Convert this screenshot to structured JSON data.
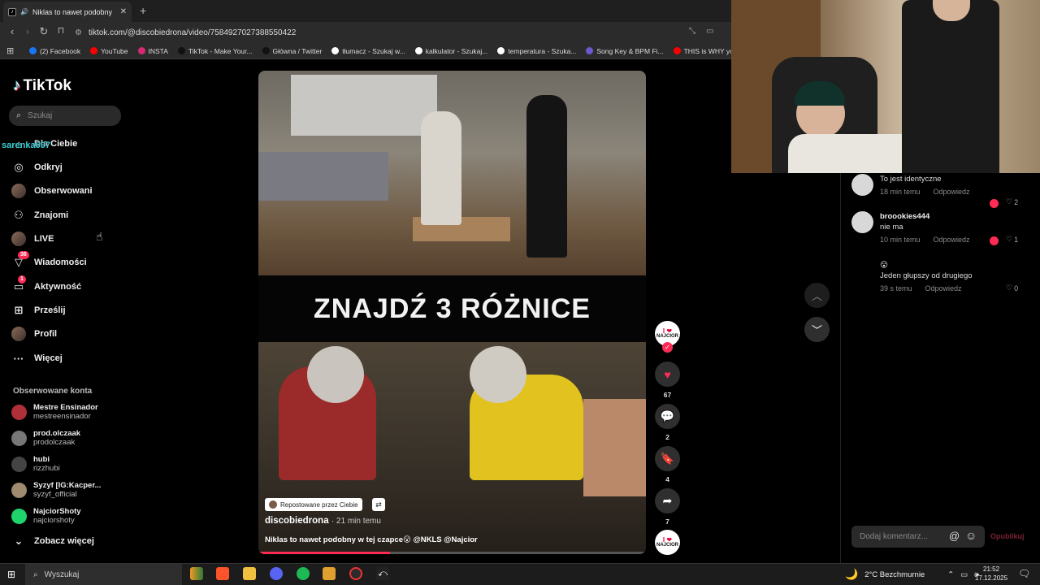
{
  "browser": {
    "tab_title": "Niklas to nawet podobny w te",
    "tab_close": "✕",
    "new_tab": "+",
    "url": "tiktok.com/@discobiedrona/video/7584927027388550422",
    "bookmarks": [
      {
        "label": "(2) Facebook",
        "color": "#1877f2"
      },
      {
        "label": "YouTube",
        "color": "#ff0000"
      },
      {
        "label": "INSTA",
        "color": "#d62976"
      },
      {
        "label": "TikTok - Make Your...",
        "color": "#111111"
      },
      {
        "label": "Główna / Twitter",
        "color": "#111111"
      },
      {
        "label": "tłumacz - Szukaj w...",
        "color": "#ffffff"
      },
      {
        "label": "kalkulator - Szukaj...",
        "color": "#ffffff"
      },
      {
        "label": "temperatura - Szuka...",
        "color": "#ffffff"
      },
      {
        "label": "Song Key & BPM Fi...",
        "color": "#6a5acd"
      },
      {
        "label": "THIS is WHY your Kl...",
        "color": "#ff0000"
      }
    ]
  },
  "sidebar": {
    "logo": "TikTok",
    "search_placeholder": "Szukaj",
    "overlay_username": "sarenka597",
    "nav": [
      {
        "label": "Dla Ciebie",
        "icon": "home-icon",
        "glyph": "⌂"
      },
      {
        "label": "Odkryj",
        "icon": "compass-icon",
        "glyph": "◎"
      },
      {
        "label": "Obserwowani",
        "icon": "following-avatar-icon",
        "glyph": ""
      },
      {
        "label": "Znajomi",
        "icon": "friends-icon",
        "glyph": "⚇"
      },
      {
        "label": "LIVE",
        "icon": "live-avatar-icon",
        "glyph": ""
      },
      {
        "label": "Wiadomości",
        "icon": "messages-icon",
        "glyph": "▽",
        "badge": "36"
      },
      {
        "label": "Aktywność",
        "icon": "activity-icon",
        "glyph": "▭",
        "badge": "1"
      },
      {
        "label": "Prześlij",
        "icon": "upload-icon",
        "glyph": "⊞"
      },
      {
        "label": "Profil",
        "icon": "profile-avatar-icon",
        "glyph": ""
      },
      {
        "label": "Więcej",
        "icon": "more-icon",
        "glyph": "···"
      }
    ],
    "followed_title": "Obserwowane konta",
    "followed": [
      {
        "name": "Mestre Ensinador",
        "handle": "mestreensinador"
      },
      {
        "name": "prod.olczaak",
        "handle": "prodolczaak"
      },
      {
        "name": "hubi",
        "handle": "rizzhubi"
      },
      {
        "name": "Syzyf [IG:Kacper...",
        "handle": "syzyf_official"
      },
      {
        "name": "NajciorShoty",
        "handle": "najciorshoty"
      }
    ],
    "see_more": "Zobacz więcej"
  },
  "video": {
    "caption": "ZNAJDŹ 3 RÓŻNICE",
    "repost_label": "Repostowane przez Ciebie",
    "author": "discobiedrona",
    "time": "· 21 min temu",
    "description": "Niklas to nawet podobny w tej czapce😮 @NKLS @Najcior",
    "progress": 0.34
  },
  "actions": {
    "creator_badge_line1": "I ❤",
    "creator_badge_line2": "NAJCIOR",
    "likes": "67",
    "comments": "2",
    "saves": "4",
    "shares": "7"
  },
  "comments": {
    "items": [
      {
        "user": "",
        "text": "To jest identyczne",
        "time": "18 min temu",
        "reply": "Odpowiedz",
        "likes": "2"
      },
      {
        "user": "broookies444",
        "text": "nie ma",
        "time": "10 min temu",
        "reply": "Odpowiedz",
        "likes": "1"
      },
      {
        "user": "😮",
        "text": "Jeden głupszy od drugiego",
        "time": "39 s temu",
        "reply": "Odpowiedz",
        "likes": "0"
      }
    ],
    "input_placeholder": "Dodaj komentarz...",
    "post_label": "Opublikuj"
  },
  "taskbar": {
    "search": "Wyszukaj",
    "weather": "2°C  Bezchmurnie",
    "time": "21:52",
    "date": "17.12.2025"
  }
}
